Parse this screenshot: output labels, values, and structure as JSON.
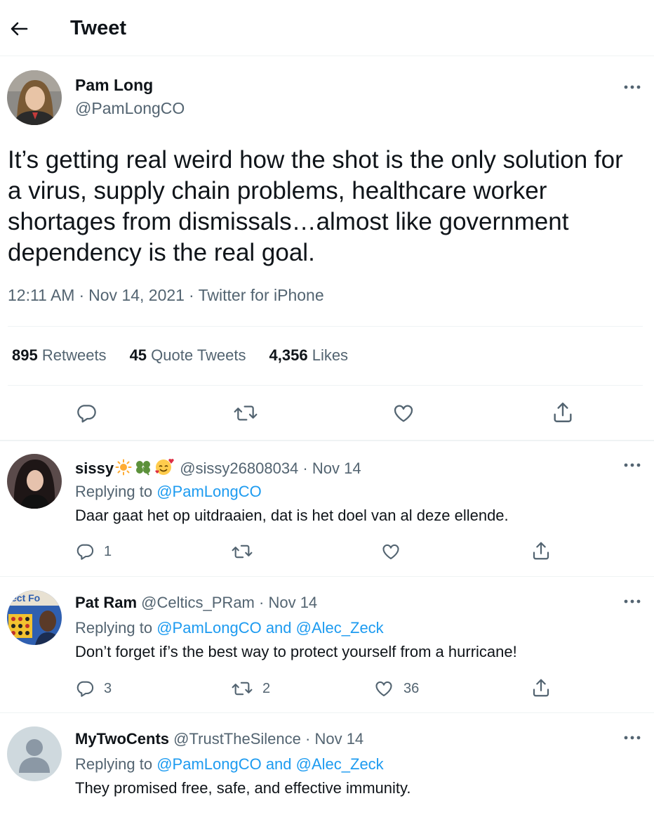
{
  "header": {
    "title": "Tweet"
  },
  "main_tweet": {
    "name": "Pam Long",
    "handle": "@PamLongCO",
    "text": "It’s getting real weird how the shot is the only solution for a virus, supply chain problems, healthcare worker shortages from dismissals…almost like government dependency is the real goal.",
    "time": "12:11 AM",
    "date": "Nov 14, 2021",
    "source": "Twitter for iPhone",
    "stats": {
      "retweets_count": "895",
      "retweets_label": "Retweets",
      "quotes_count": "45",
      "quotes_label": "Quote Tweets",
      "likes_count": "4,356",
      "likes_label": "Likes"
    }
  },
  "replies": [
    {
      "name": "sissy",
      "handle": "@sissy26808034",
      "date": "Nov 14",
      "replying_prefix": "Replying to",
      "replying_to": "@PamLongCO",
      "text": "Daar gaat het op uitdraaien, dat is het doel van al deze ellende.",
      "reply_count": "1",
      "retweet_count": "",
      "like_count": ""
    },
    {
      "name": "Pat Ram",
      "handle": "@Celtics_PRam",
      "date": "Nov 14",
      "replying_prefix": "Replying to",
      "replying_to": "@PamLongCO and @Alec_Zeck",
      "text": "Don’t forget if’s the best way to protect yourself from a hurricane!",
      "reply_count": "3",
      "retweet_count": "2",
      "like_count": "36"
    },
    {
      "name": "MyTwoCents",
      "handle": "@TrustTheSilence",
      "date": "Nov 14",
      "replying_prefix": "Replying to",
      "replying_to": "@PamLongCO and @Alec_Zeck",
      "text": "They promised free, safe, and effective immunity."
    }
  ],
  "separator": "·",
  "icons": {
    "back": "arrow-left-icon",
    "more": "more-dots-icon",
    "reply": "reply-icon",
    "retweet": "retweet-icon",
    "like": "heart-icon",
    "share": "share-icon",
    "sun": "sun-emoji-icon",
    "clover": "clover-emoji-icon",
    "smile": "smiling-hearts-emoji-icon"
  },
  "colors": {
    "link": "#1d9bf0",
    "secondary_text": "#536471",
    "primary_text": "#0f1419",
    "divider": "#eff3f4"
  }
}
